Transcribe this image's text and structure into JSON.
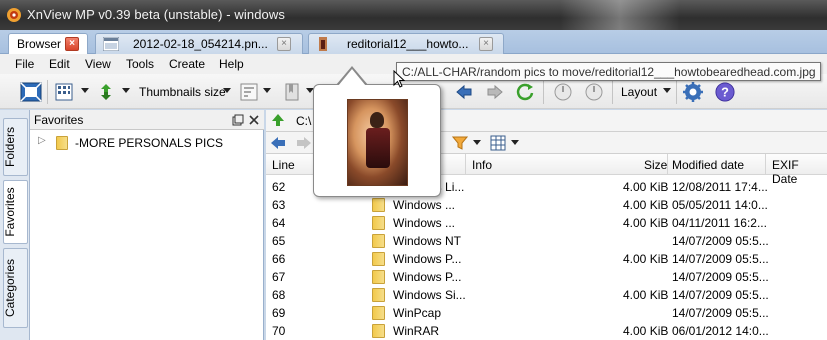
{
  "window": {
    "title": "XnView MP v0.39 beta (unstable) - windows"
  },
  "tabs": [
    {
      "label": "Browser"
    },
    {
      "label": "2012-02-18_054214.pn..."
    },
    {
      "label": "reditorial12___howto..."
    }
  ],
  "menu": [
    "File",
    "Edit",
    "View",
    "Tools",
    "Create",
    "Help"
  ],
  "toolbar": {
    "thumbnails_size_label": "Thumbnails size",
    "layout_label": "Layout"
  },
  "tooltip": {
    "path": "C:/ALL-CHAR/random pics to move/reditorial12___howtobearedhead.com.jpg"
  },
  "sidetabs": [
    "Folders",
    "Favorites",
    "Categories"
  ],
  "favorites": {
    "title": "Favorites",
    "items": [
      {
        "label": "-MORE PERSONALS PICS"
      }
    ]
  },
  "address": {
    "value": "C:\\"
  },
  "columns": {
    "line": "Line",
    "info": "Info",
    "size": "Size",
    "modified": "Modified date",
    "exif": "EXIF Date"
  },
  "rows": [
    {
      "line": "62",
      "name": "Windows Li...",
      "size": "4.00 KiB",
      "date": "12/08/2011 17:4..."
    },
    {
      "line": "63",
      "name": "Windows ...",
      "size": "4.00 KiB",
      "date": "05/05/2011 14:0..."
    },
    {
      "line": "64",
      "name": "Windows ...",
      "size": "4.00 KiB",
      "date": "04/11/2011 16:2..."
    },
    {
      "line": "65",
      "name": "Windows NT",
      "size": "",
      "date": "14/07/2009 05:5..."
    },
    {
      "line": "66",
      "name": "Windows P...",
      "size": "4.00 KiB",
      "date": "14/07/2009 05:5..."
    },
    {
      "line": "67",
      "name": "Windows P...",
      "size": "",
      "date": "14/07/2009 05:5..."
    },
    {
      "line": "68",
      "name": "Windows Si...",
      "size": "4.00 KiB",
      "date": "14/07/2009 05:5..."
    },
    {
      "line": "69",
      "name": "WinPcap",
      "size": "",
      "date": "14/07/2009 05:5..."
    },
    {
      "line": "70",
      "name": "WinRAR",
      "size": "4.00 KiB",
      "date": "06/01/2012 14:0..."
    }
  ],
  "colors": {
    "accent": "#d9452b",
    "titlebar": "#3a3a3a",
    "folder": "#f2c94c"
  }
}
